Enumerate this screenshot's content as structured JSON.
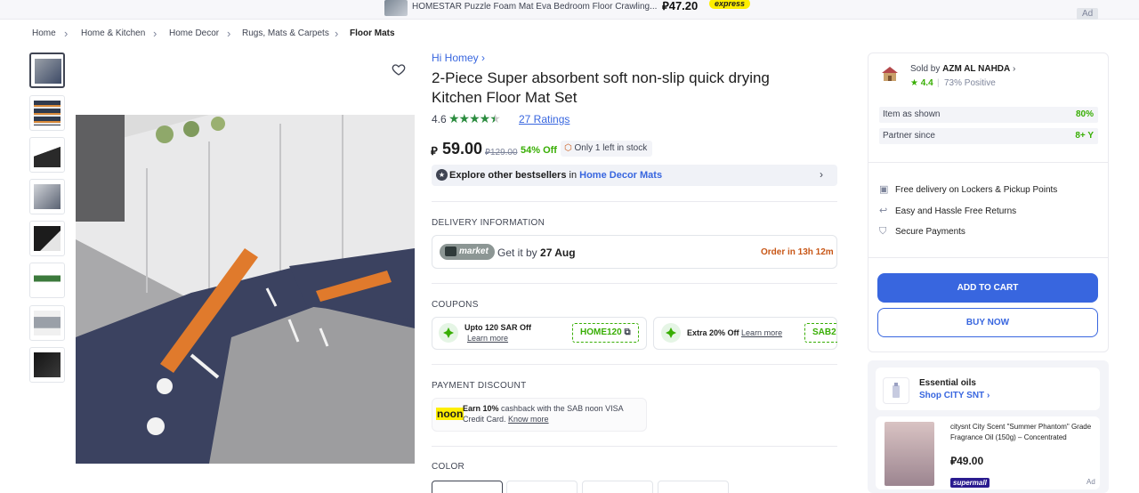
{
  "top_ad": {
    "title": "HOMESTAR Puzzle Foam Mat Eva Bedroom Floor Crawling...",
    "price": "⃁47.20",
    "badge": "express",
    "ad_label": "Ad"
  },
  "breadcrumb": [
    "Home",
    "Home & Kitchen",
    "Home Decor",
    "Rugs, Mats & Carpets",
    "Floor Mats"
  ],
  "product": {
    "brand_link": "Hi Homey",
    "title": "2-Piece Super absorbent soft non-slip quick drying Kitchen Floor Mat Set",
    "rating": "4.6",
    "stars": 4.5,
    "ratings_count": "27 Ratings",
    "currency_symbol": "⃁",
    "price": "59.00",
    "old_price": "⃁129.00",
    "discount": "54% Off",
    "stock": "Only 1 left in stock",
    "bestseller_prefix": "Explore other bestsellers",
    "bestseller_in": "in",
    "bestseller_category": "Home Decor Mats"
  },
  "delivery": {
    "heading": "DELIVERY INFORMATION",
    "badge": "market",
    "get_it_prefix": "Get it by",
    "date": "27 Aug",
    "order_in": "Order in 13h 12m"
  },
  "coupons": {
    "heading": "COUPONS",
    "items": [
      {
        "line1": "Upto 120 SAR Off",
        "learn": "Learn more",
        "code": "HOME120"
      },
      {
        "line1": "Extra 20% Off",
        "learn": "Learn more",
        "code": "SAB2"
      }
    ]
  },
  "payment": {
    "heading": "PAYMENT DISCOUNT",
    "logo": "noon",
    "earn": "Earn 10%",
    "text": "cashback with the SAB noon VISA Credit Card.",
    "know_more": "Know more"
  },
  "color": {
    "heading": "COLOR"
  },
  "seller": {
    "sold_by_label": "Sold by",
    "name": "AZM AL NAHDA",
    "rating": "4.4",
    "positive": "73% Positive",
    "stats": [
      {
        "label": "Item as shown",
        "value": "80%"
      },
      {
        "label": "Partner since",
        "value": "8+ Y"
      }
    ],
    "perks": [
      "Free delivery on Lockers & Pickup Points",
      "Easy and Hassle Free Returns",
      "Secure Payments"
    ],
    "add_to_cart": "ADD TO CART",
    "buy_now": "BUY NOW"
  },
  "side_ad": {
    "title": "Essential oils",
    "shop_link": "Shop CITY SNT",
    "product_name": "citysnt City Scent \"Summer Phantom\" Grade Fragrance Oil (150g) – Concentrated",
    "price": "⃁49.00",
    "badge": "supermall",
    "ad_label": "Ad"
  },
  "colors": {
    "accent": "#3866df",
    "green": "#38ae04",
    "star_green": "#2b8c3f",
    "order_orange": "#c85717"
  }
}
